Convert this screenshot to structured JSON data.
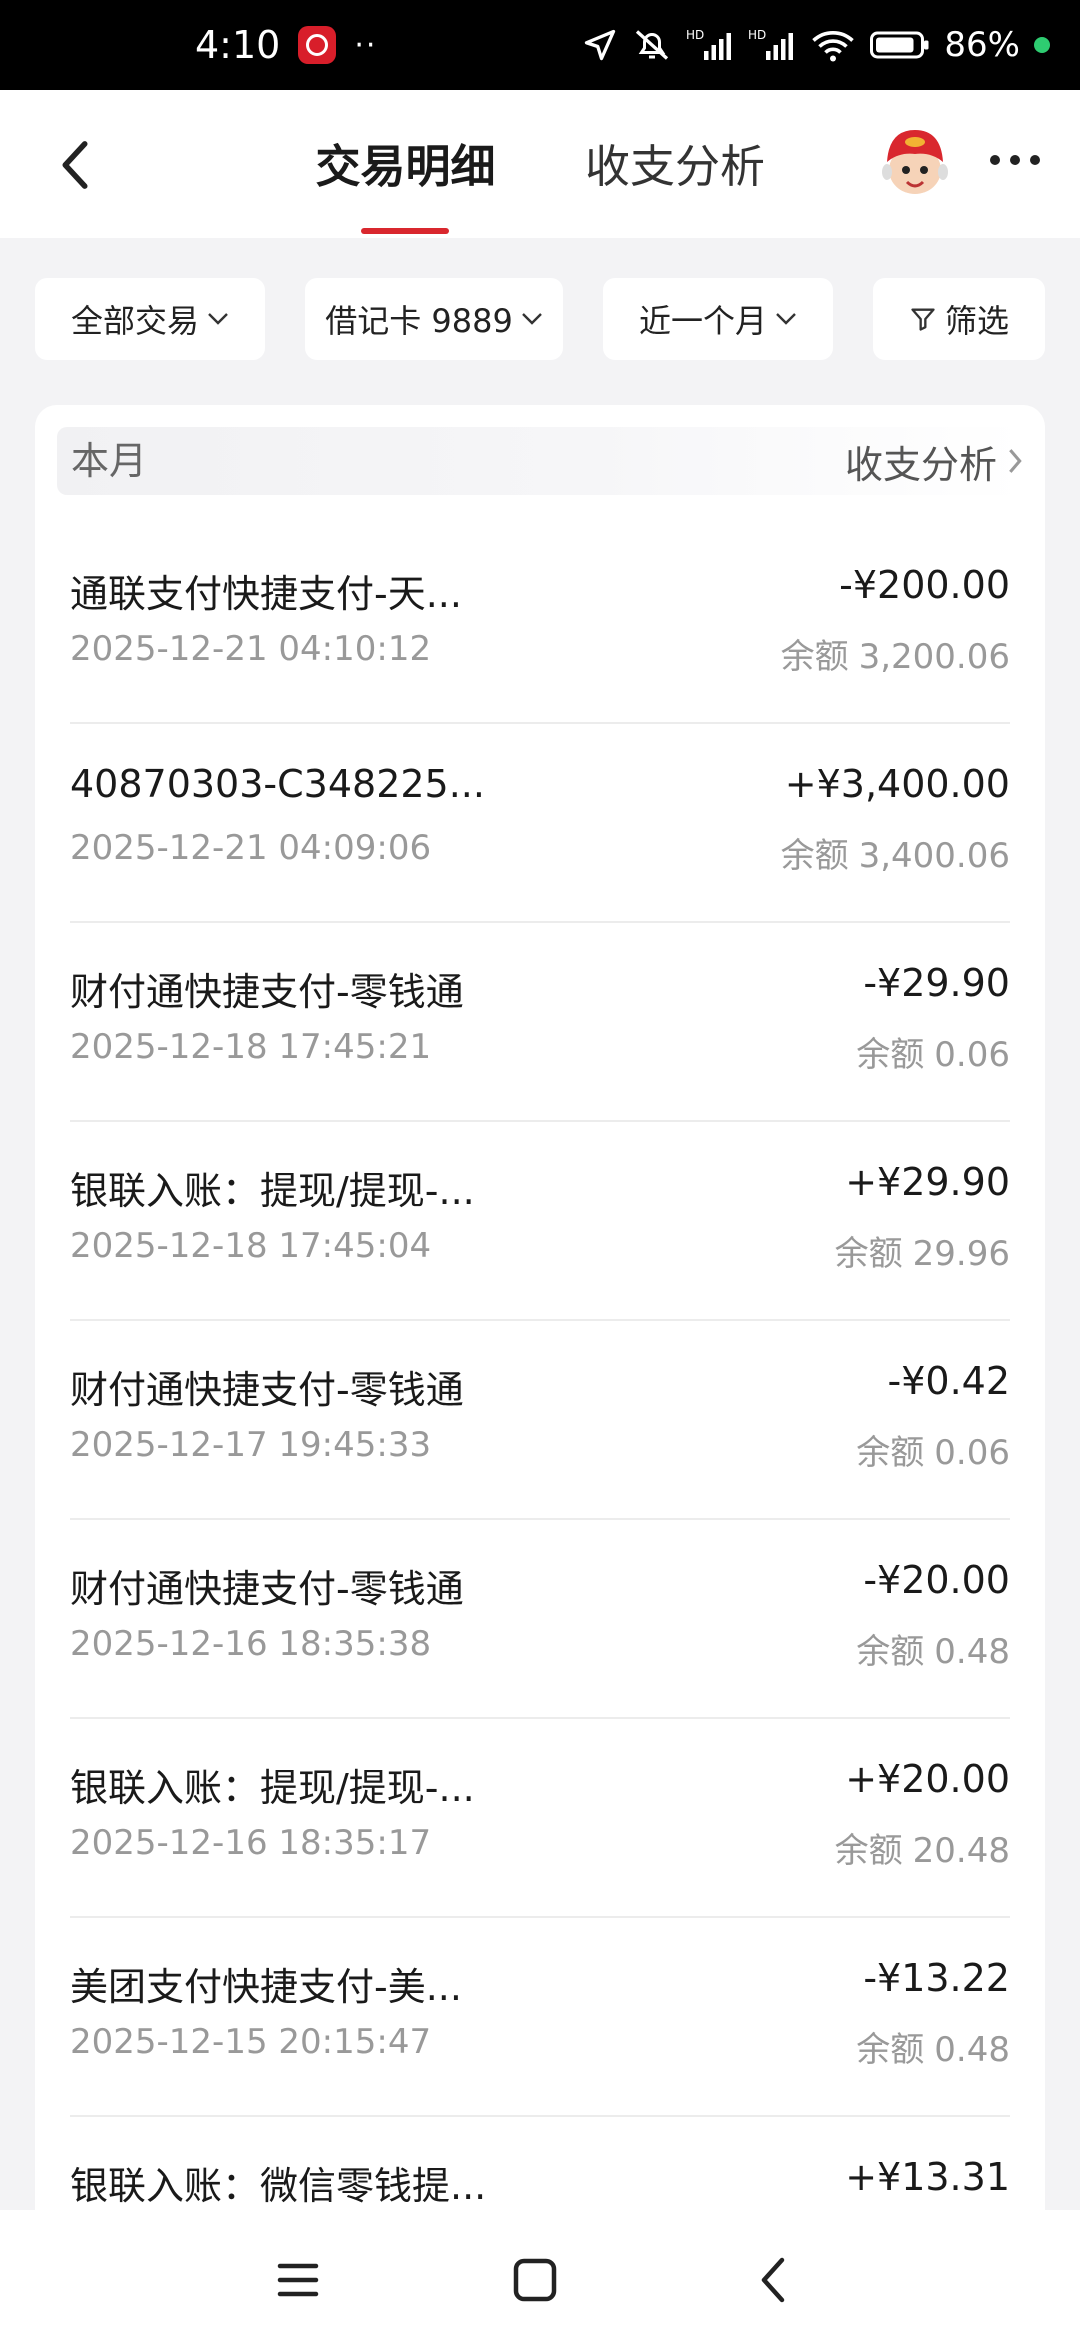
{
  "status_bar": {
    "time": "4:10",
    "dots": "··",
    "battery_text": "86%",
    "icons": [
      "location-icon",
      "mute-icon",
      "signal-hd-icon",
      "signal-hd-icon",
      "wifi-icon",
      "battery-icon"
    ],
    "battery_level": 0.86,
    "dot_color": "#2ecc71"
  },
  "header": {
    "tabs": [
      {
        "label": "交易明细",
        "active": true
      },
      {
        "label": "收支分析",
        "active": false
      }
    ],
    "accent_color": "#d9272e"
  },
  "filters": [
    {
      "label": "全部交易",
      "icon": "chevron-down-icon"
    },
    {
      "label": "借记卡 9889",
      "icon": "chevron-down-icon"
    },
    {
      "label": "近一个月",
      "icon": "chevron-down-icon"
    },
    {
      "label": "筛选",
      "icon": "filter-icon"
    }
  ],
  "month": {
    "label": "本月",
    "analysis_link": "收支分析"
  },
  "balance_label": "余额",
  "transactions": [
    {
      "title": "通联支付快捷支付-天...",
      "time": "2025-12-21 04:10:12",
      "amount": "-¥200.00",
      "balance": "3,200.06"
    },
    {
      "title": "40870303-C348225...",
      "time": "2025-12-21 04:09:06",
      "amount": "+¥3,400.00",
      "balance": "3,400.06"
    },
    {
      "title": "财付通快捷支付-零钱通",
      "time": "2025-12-18 17:45:21",
      "amount": "-¥29.90",
      "balance": "0.06"
    },
    {
      "title": "银联入账：提现/提现-...",
      "time": "2025-12-18 17:45:04",
      "amount": "+¥29.90",
      "balance": "29.96"
    },
    {
      "title": "财付通快捷支付-零钱通",
      "time": "2025-12-17 19:45:33",
      "amount": "-¥0.42",
      "balance": "0.06"
    },
    {
      "title": "财付通快捷支付-零钱通",
      "time": "2025-12-16 18:35:38",
      "amount": "-¥20.00",
      "balance": "0.48"
    },
    {
      "title": "银联入账：提现/提现-...",
      "time": "2025-12-16 18:35:17",
      "amount": "+¥20.00",
      "balance": "20.48"
    },
    {
      "title": "美团支付快捷支付-美...",
      "time": "2025-12-15 20:15:47",
      "amount": "-¥13.22",
      "balance": "0.48"
    },
    {
      "title": "银联入账：微信零钱提...",
      "time": "",
      "amount": "+¥13.31",
      "balance": ""
    }
  ],
  "bottom_nav": [
    "menu-icon",
    "home-icon",
    "back-icon"
  ]
}
